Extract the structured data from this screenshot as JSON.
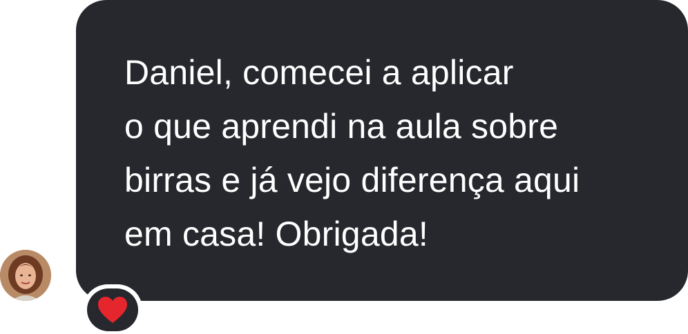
{
  "message": {
    "lines": [
      "Daniel, comecei a aplicar",
      "o que aprendi na aula sobre",
      "birras e já vejo diferença aqui",
      "em casa! Obrigada!"
    ]
  },
  "reaction": {
    "icon": "heart-icon",
    "color": "#e5262d"
  },
  "avatar": {
    "icon": "user-avatar"
  },
  "colors": {
    "bubble": "#26282e",
    "text": "#ffffff",
    "background": "#ffffff"
  }
}
